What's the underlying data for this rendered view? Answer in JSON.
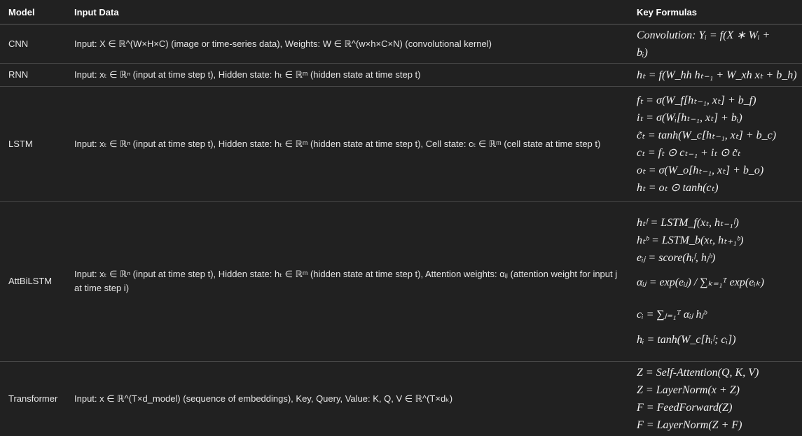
{
  "headers": {
    "model": "Model",
    "input": "Input Data",
    "formulas": "Key Formulas"
  },
  "rows": [
    {
      "model": "CNN",
      "input": "Input: X ∈ ℝ^(W×H×C) (image or time-series data), Weights: W ∈ ℝ^(w×h×C×N) (convolutional kernel)",
      "formulas": [
        "Convolution: Yᵢ = f(X ∗ Wᵢ +",
        "bᵢ)"
      ]
    },
    {
      "model": "RNN",
      "input": "Input: xₜ ∈ ℝⁿ (input at time step t), Hidden state: hₜ ∈ ℝᵐ (hidden state at time step t)",
      "formulas": [
        "hₜ = f(W_hh hₜ₋₁ + W_xh xₜ + b_h)"
      ]
    },
    {
      "model": "LSTM",
      "input": "Input: xₜ ∈ ℝⁿ (input at time step t), Hidden state: hₜ ∈ ℝᵐ (hidden state at time step t), Cell state: cₜ ∈ ℝᵐ (cell state at time step t)",
      "formulas": [
        "fₜ = σ(W_f[hₜ₋₁, xₜ] + b_f)",
        "iₜ = σ(Wᵢ[hₜ₋₁, xₜ] + bᵢ)",
        "c̃ₜ = tanh(W_c[hₜ₋₁, xₜ] + b_c)",
        "cₜ = fₜ ⊙ cₜ₋₁ + iₜ ⊙ c̃ₜ",
        "oₜ = σ(W_o[hₜ₋₁, xₜ] + b_o)",
        "hₜ = oₜ ⊙ tanh(cₜ)"
      ]
    },
    {
      "model": "AttBiLSTM",
      "input": "Input: xₜ ∈ ℝⁿ (input at time step t), Hidden state: hₜ ∈ ℝᵐ (hidden state at time step t), Attention weights: αᵢⱼ (attention weight for input j at time step i)",
      "formulas": [
        "hₜᶠ = LSTM_f(xₜ, hₜ₋₁ᶠ)",
        "hₜᵇ = LSTM_b(xₜ, hₜ₊₁ᵇ)",
        "eᵢⱼ = score(hᵢᶠ, hⱼᵇ)",
        "αᵢⱼ = exp(eᵢⱼ) / ∑ₖ₌₁ᵀ exp(eᵢₖ)",
        "cᵢ = ∑ⱼ₌₁ᵀ αᵢⱼ hⱼᵇ",
        "hᵢ = tanh(W_c[hᵢᶠ; cᵢ])"
      ]
    },
    {
      "model": "Transformer",
      "input": "Input: x ∈ ℝ^(T×d_model) (sequence of embeddings), Key, Query, Value: K, Q, V ∈ ℝ^(T×dₖ)",
      "formulas": [
        "Z = Self-Attention(Q, K, V)",
        "Z = LayerNorm(x + Z)",
        "F = FeedForward(Z)",
        "F = LayerNorm(Z + F)"
      ]
    }
  ]
}
